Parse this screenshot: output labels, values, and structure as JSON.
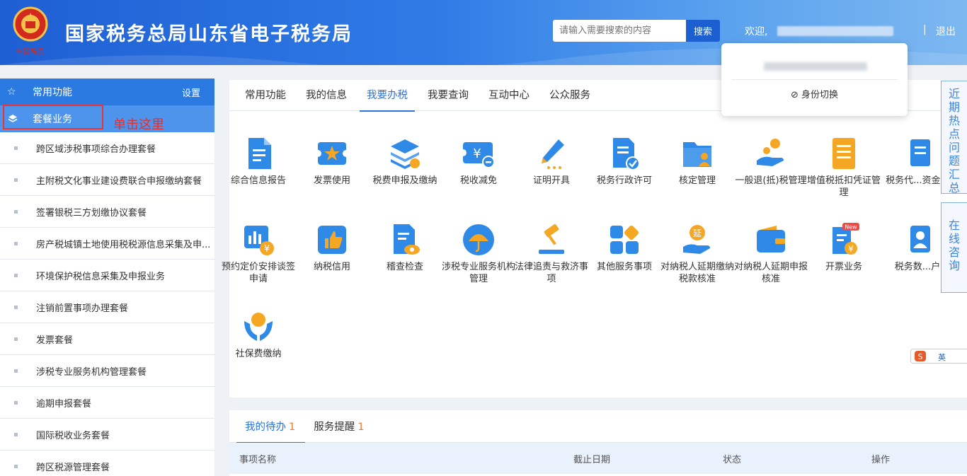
{
  "header": {
    "title": "国家税务总局山东省电子税务局",
    "search_placeholder": "请输入需要搜索的内容",
    "search_button": "搜索",
    "welcome": "欢迎,",
    "separator": "|",
    "logout": "退出"
  },
  "popup": {
    "switch_identity": "身份切换"
  },
  "sidebar": {
    "common_label": "常用功能",
    "settings_label": "设置",
    "package_label": "套餐业务",
    "hint": "单击这里",
    "items": [
      "跨区域涉税事项综合办理套餐",
      "主附税文化事业建设费联合申报缴纳套餐",
      "签署银税三方划缴协议套餐",
      "房产税城镇土地使用税税源信息采集及申...",
      "环境保护税信息采集及申报业务",
      "注销前置事项办理套餐",
      "发票套餐",
      "涉税专业服务机构管理套餐",
      "逾期申报套餐",
      "国际税收业务套餐",
      "跨区税源管理套餐"
    ]
  },
  "main": {
    "tabs": [
      "常用功能",
      "我的信息",
      "我要办税",
      "我要查询",
      "互动中心",
      "公众服务"
    ],
    "active_tab": "我要办税",
    "tiles": [
      {
        "label": "综合信息报告",
        "icon": "report-icon"
      },
      {
        "label": "发票使用",
        "icon": "invoice-star-icon"
      },
      {
        "label": "税费申报及缴纳",
        "icon": "declare-layers-icon"
      },
      {
        "label": "税收减免",
        "icon": "tax-reduction-icon"
      },
      {
        "label": "证明开具",
        "icon": "pen-certificate-icon"
      },
      {
        "label": "税务行政许可",
        "icon": "permit-check-icon"
      },
      {
        "label": "核定管理",
        "icon": "folder-person-icon"
      },
      {
        "label": "一般退(抵)税管理",
        "icon": "refund-coin-hand-icon"
      },
      {
        "label": "增值税抵扣凭证管理",
        "icon": "vat-document-icon"
      },
      {
        "label": "税务代...资金...",
        "icon": "agent-fund-icon"
      },
      {
        "label": "预约定价安排谈签申请",
        "icon": "chart-yuan-icon"
      },
      {
        "label": "纳税信用",
        "icon": "thumbs-up-icon"
      },
      {
        "label": "稽查检查",
        "icon": "eye-document-icon"
      },
      {
        "label": "涉税专业服务机构管理",
        "icon": "umbrella-icon"
      },
      {
        "label": "法律追责与救济事项",
        "icon": "gavel-icon"
      },
      {
        "label": "其他服务事项",
        "icon": "grid-diamond-icon"
      },
      {
        "label": "对纳税人延期缴纳税款核准",
        "icon": "extend-hand-icon"
      },
      {
        "label": "对纳税人延期申报核准",
        "icon": "wallet-icon"
      },
      {
        "label": "开票业务",
        "icon": "new-invoice-icon",
        "badge": "New"
      },
      {
        "label": "税务数...户",
        "icon": "tax-user-icon"
      },
      {
        "label": "社保费缴纳",
        "icon": "social-security-hands-icon"
      }
    ]
  },
  "float": {
    "hot": "近期热点问题汇总",
    "consult": "在线咨询",
    "ime": "英"
  },
  "todo": {
    "tabs": [
      {
        "label": "我的待办",
        "count": "1"
      },
      {
        "label": "服务提醒",
        "count": "1"
      }
    ],
    "columns": [
      "事项名称",
      "截止日期",
      "状态",
      "操作"
    ]
  }
}
